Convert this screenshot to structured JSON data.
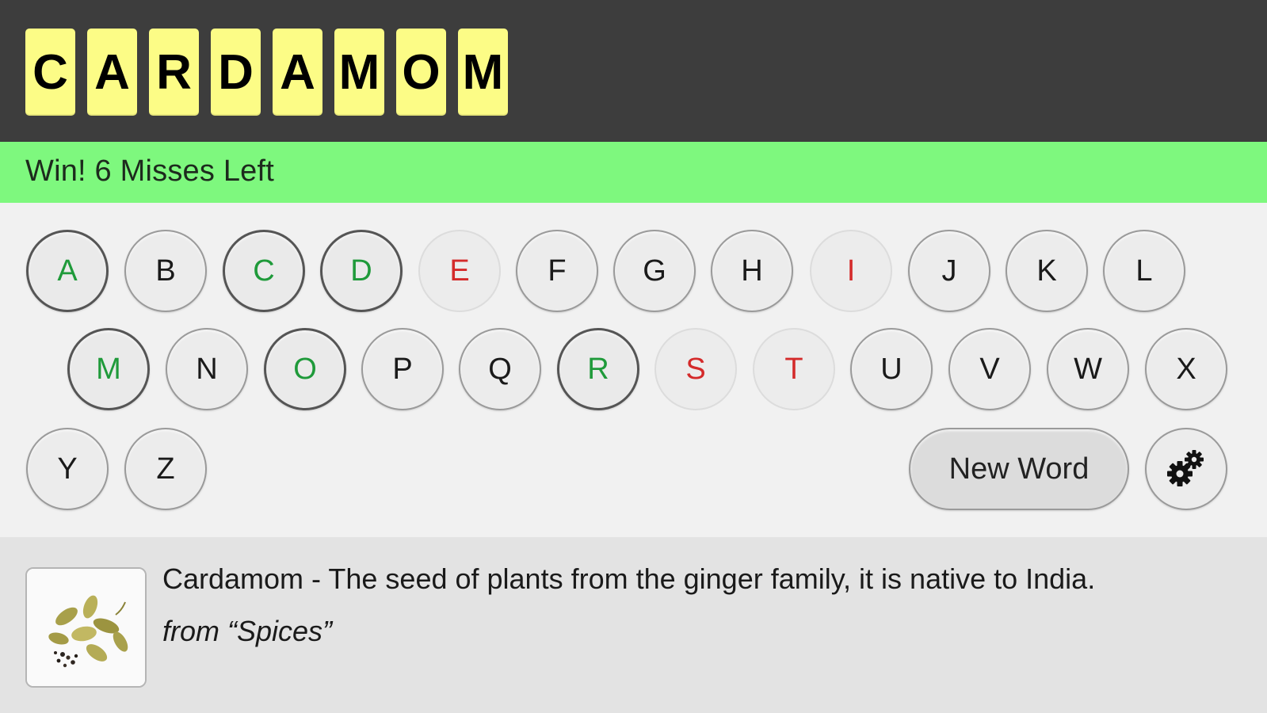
{
  "word": {
    "letters": [
      "C",
      "A",
      "R",
      "D",
      "A",
      "M",
      "O",
      "M"
    ]
  },
  "status": {
    "text": "Win! 6 Misses Left"
  },
  "keyboard": {
    "row1": [
      {
        "letter": "A",
        "state": "hit"
      },
      {
        "letter": "B",
        "state": "unused"
      },
      {
        "letter": "C",
        "state": "hit"
      },
      {
        "letter": "D",
        "state": "hit"
      },
      {
        "letter": "E",
        "state": "miss"
      },
      {
        "letter": "F",
        "state": "unused"
      },
      {
        "letter": "G",
        "state": "unused"
      },
      {
        "letter": "H",
        "state": "unused"
      },
      {
        "letter": "I",
        "state": "miss"
      },
      {
        "letter": "J",
        "state": "unused"
      },
      {
        "letter": "K",
        "state": "unused"
      },
      {
        "letter": "L",
        "state": "unused"
      }
    ],
    "row2": [
      {
        "letter": "M",
        "state": "hit"
      },
      {
        "letter": "N",
        "state": "unused"
      },
      {
        "letter": "O",
        "state": "hit"
      },
      {
        "letter": "P",
        "state": "unused"
      },
      {
        "letter": "Q",
        "state": "unused"
      },
      {
        "letter": "R",
        "state": "hit"
      },
      {
        "letter": "S",
        "state": "miss"
      },
      {
        "letter": "T",
        "state": "miss"
      },
      {
        "letter": "U",
        "state": "unused"
      },
      {
        "letter": "V",
        "state": "unused"
      },
      {
        "letter": "W",
        "state": "unused"
      },
      {
        "letter": "X",
        "state": "unused"
      }
    ],
    "row3": [
      {
        "letter": "Y",
        "state": "unused"
      },
      {
        "letter": "Z",
        "state": "unused"
      }
    ]
  },
  "controls": {
    "new_word_label": "New Word",
    "settings_icon": "gears-icon"
  },
  "info": {
    "definition": "Cardamom - The seed of plants from the ginger family, it is native to India.",
    "source": "from “Spices”",
    "thumbnail_icon": "cardamom-pods-image"
  },
  "colors": {
    "tile": "#fcfc86",
    "status_win": "#7ef87e",
    "hit_letter": "#1f9a3a",
    "miss_letter": "#d42a2a"
  }
}
